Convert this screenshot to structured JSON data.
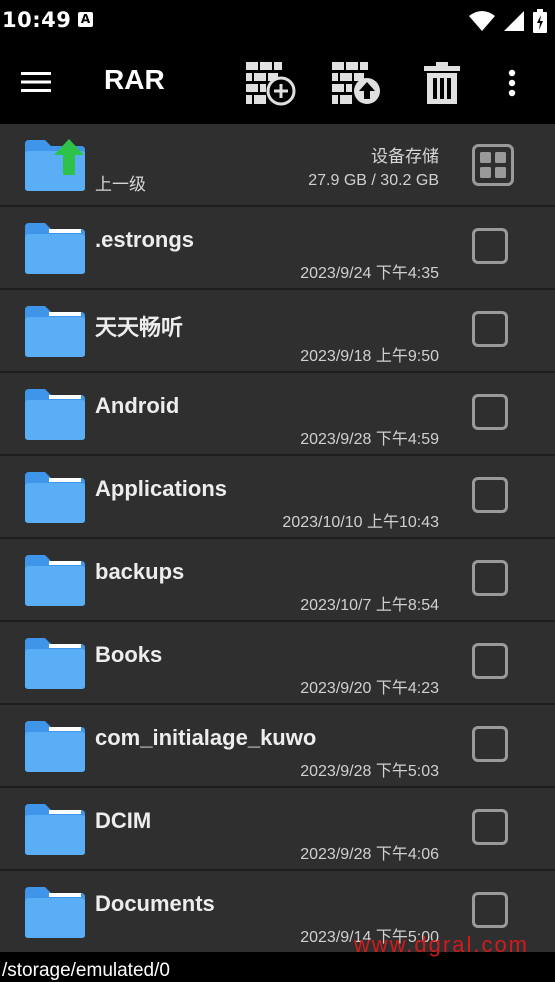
{
  "status_bar": {
    "time": "10:49",
    "notification_badge": "A",
    "icons": [
      "wifi-icon",
      "signal-icon",
      "battery-icon"
    ]
  },
  "toolbar": {
    "title": "RAR",
    "icons": [
      "menu-icon",
      "add-to-archive-icon",
      "extract-icon",
      "delete-icon",
      "more-vert-icon"
    ]
  },
  "parent_row": {
    "label": "上一级",
    "storage_label": "设备存储",
    "storage_size": "27.9 GB / 30.2 GB"
  },
  "files": [
    {
      "name": ".estrongs",
      "date": "2023/9/24 下午4:35"
    },
    {
      "name": "天天畅听",
      "date": "2023/9/18 上午9:50"
    },
    {
      "name": "Android",
      "date": "2023/9/28 下午4:59"
    },
    {
      "name": "Applications",
      "date": "2023/10/10 上午10:43"
    },
    {
      "name": "backups",
      "date": "2023/10/7 上午8:54"
    },
    {
      "name": "Books",
      "date": "2023/9/20 下午4:23"
    },
    {
      "name": "com_initialage_kuwo",
      "date": "2023/9/28 下午5:03"
    },
    {
      "name": "DCIM",
      "date": "2023/9/28 下午4:06"
    },
    {
      "name": "Documents",
      "date": "2023/9/14 下午5:00"
    }
  ],
  "path": "/storage/emulated/0",
  "watermark": "www.dgral.com",
  "colors": {
    "folder": "#5aaef5",
    "folder_tab": "#3f95ea",
    "up_arrow": "#2ec24a",
    "watermark": "#d21a1a"
  }
}
